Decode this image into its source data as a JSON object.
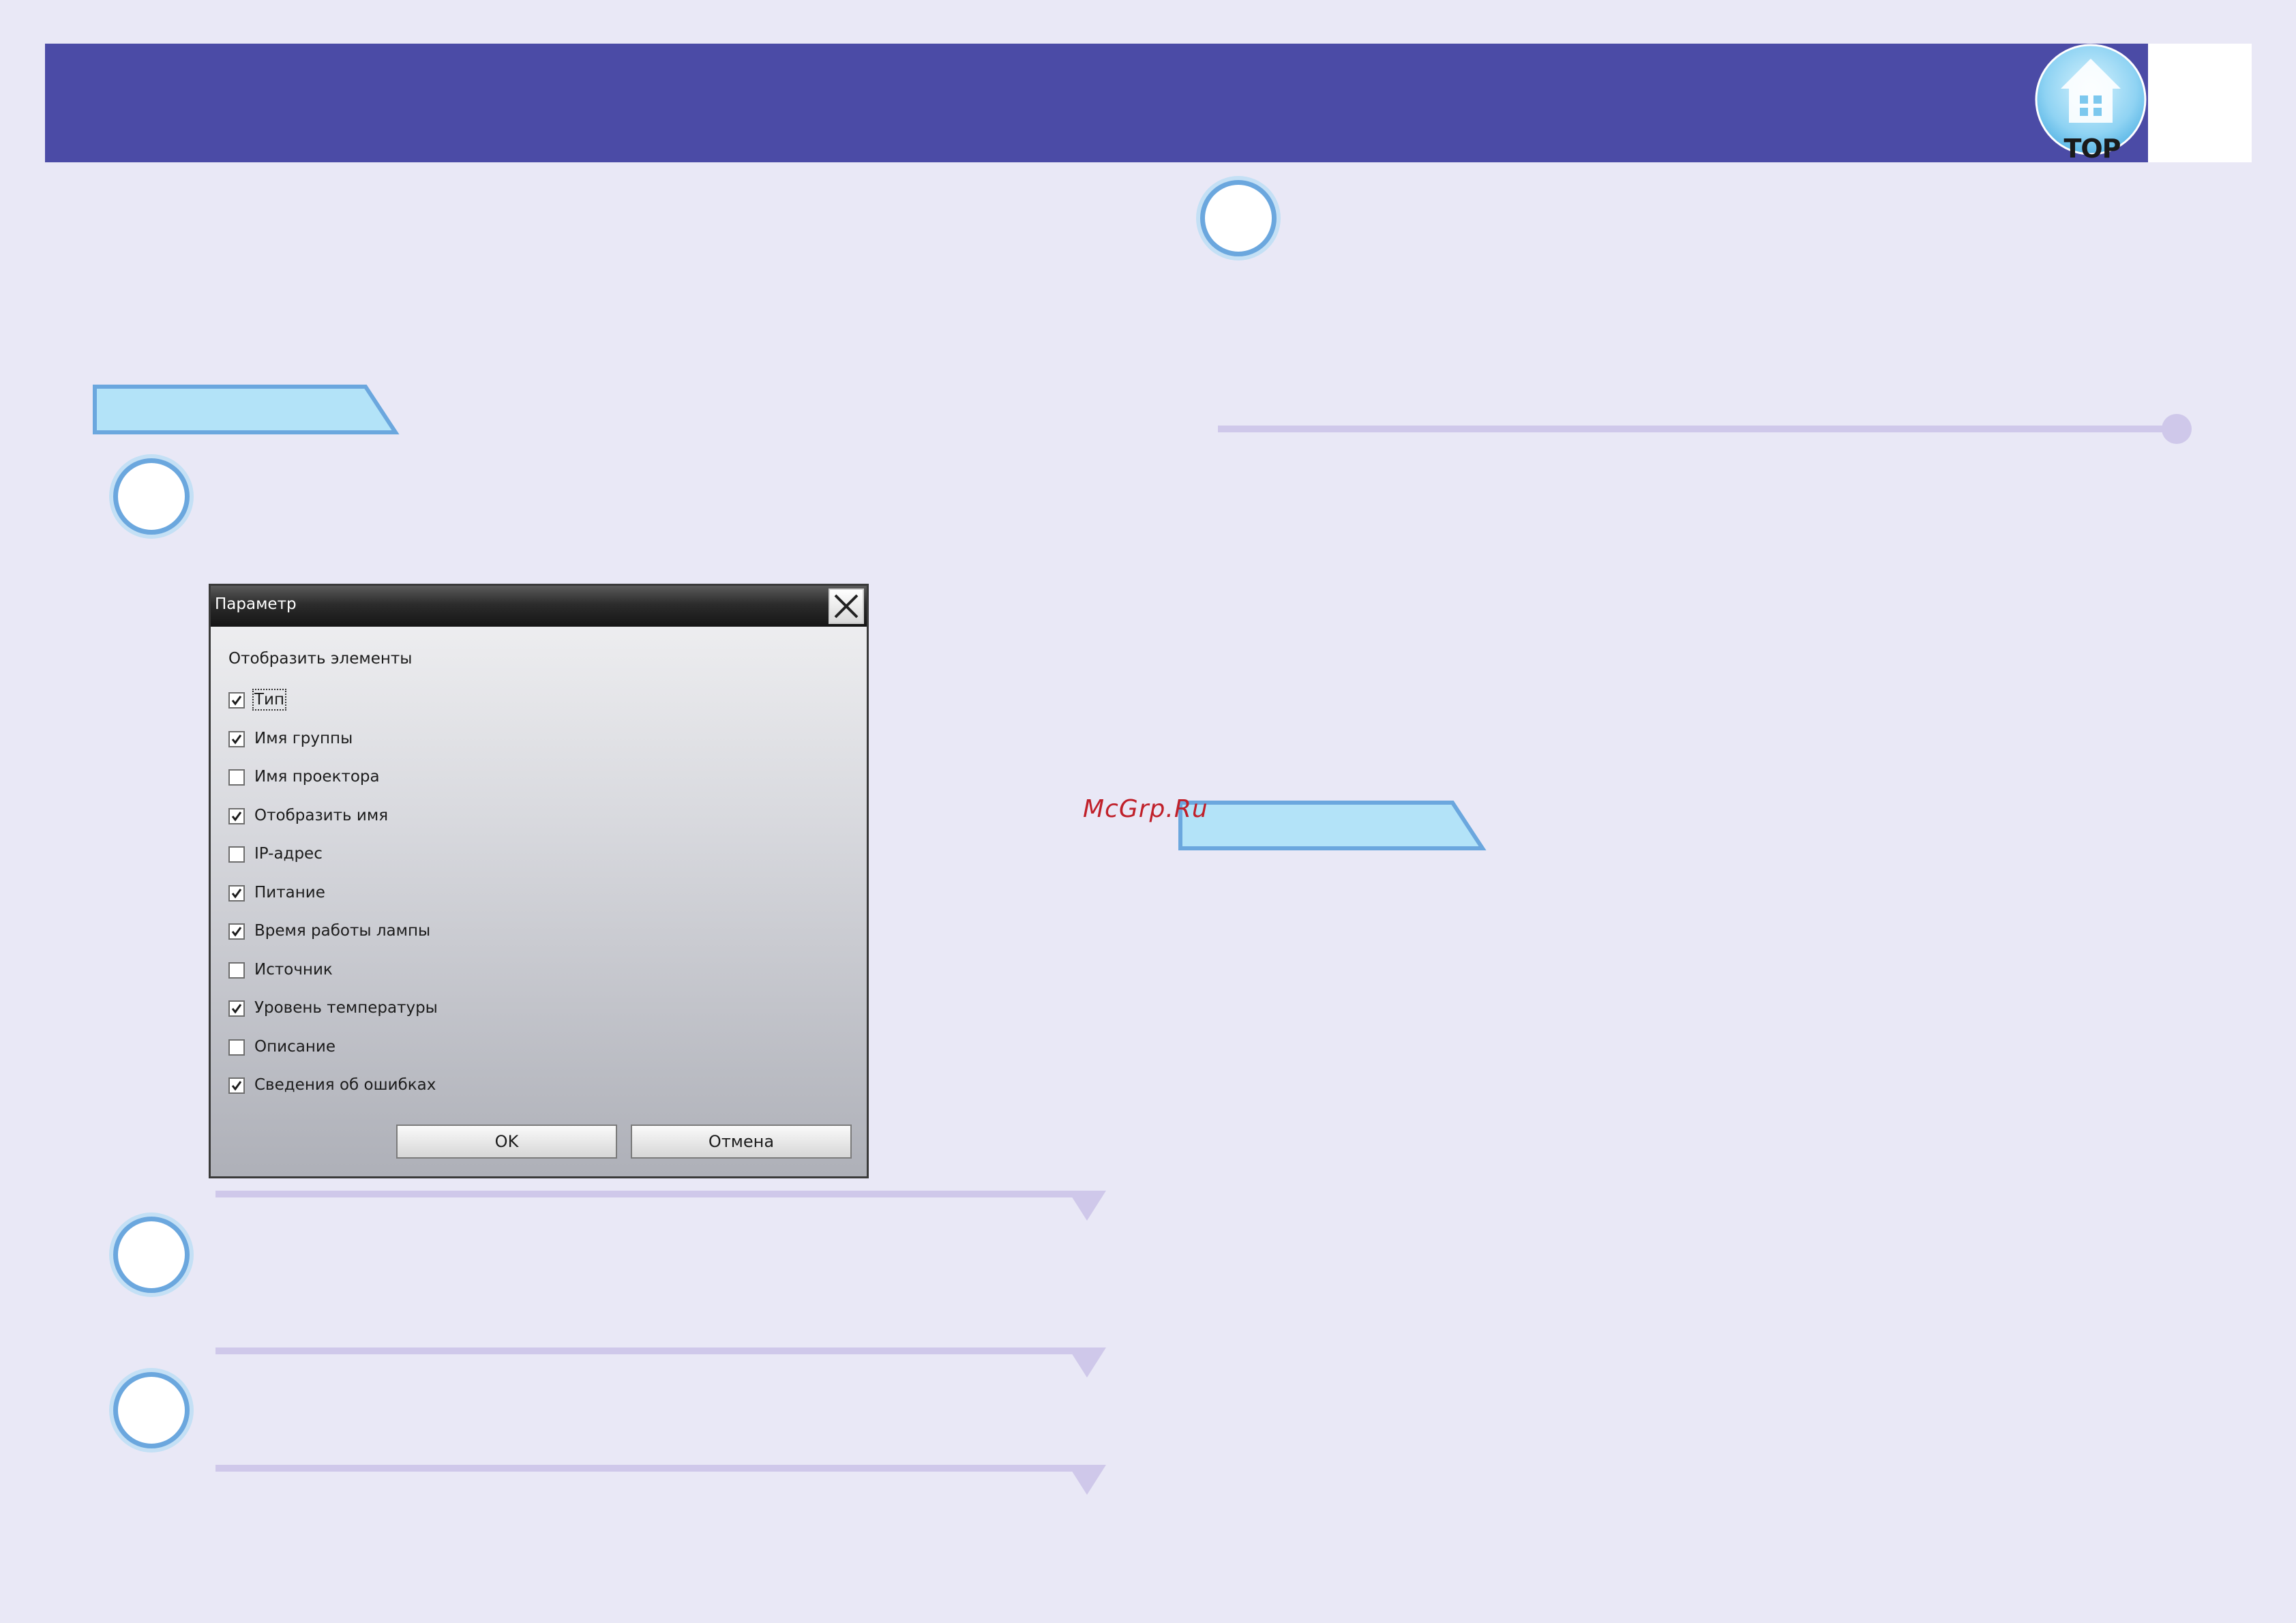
{
  "header": {
    "logo_text": "TOP"
  },
  "watermark": "McGrp.Ru",
  "dialog": {
    "title": "Параметр",
    "group_label": "Отобразить элементы",
    "items": [
      {
        "label": "Тип",
        "checked": true,
        "focused": true
      },
      {
        "label": "Имя группы",
        "checked": true
      },
      {
        "label": "Имя проектора",
        "checked": false
      },
      {
        "label": "Отобразить имя",
        "checked": true
      },
      {
        "label": "IP-адрес",
        "checked": false
      },
      {
        "label": "Питание",
        "checked": true
      },
      {
        "label": "Время работы лампы",
        "checked": true
      },
      {
        "label": "Источник",
        "checked": false
      },
      {
        "label": "Уровень температуры",
        "checked": true
      },
      {
        "label": "Описание",
        "checked": false
      },
      {
        "label": "Сведения об ошибках",
        "checked": true
      }
    ],
    "ok_label": "OK",
    "cancel_label": "Отмена"
  },
  "colors": {
    "header": "#4b4ba6",
    "accent_blue": "#6ba7de",
    "tab_fill": "#b3e3f8",
    "divider": "#cfc8ea",
    "page_bg": "#e9e8f6"
  }
}
